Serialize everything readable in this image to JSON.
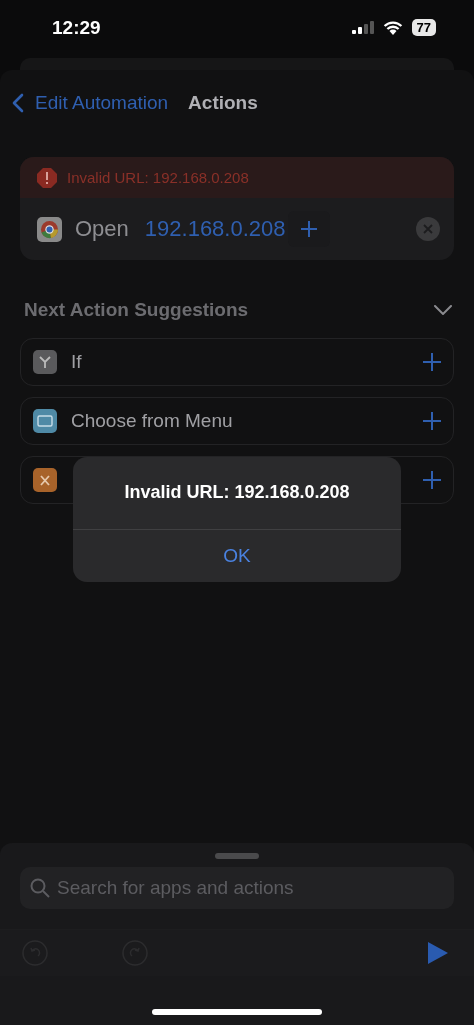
{
  "status_bar": {
    "time": "12:29",
    "battery": "77"
  },
  "nav": {
    "back": "Edit Automation",
    "title": "Actions"
  },
  "action": {
    "error": "Invalid URL: 192.168.0.208",
    "verb": "Open",
    "url": "192.168.0.208"
  },
  "suggestions": {
    "title": "Next Action Suggestions",
    "expanded": true,
    "items": [
      {
        "kind": "if",
        "label": "If"
      },
      {
        "kind": "menu",
        "label": "Choose from Menu"
      },
      {
        "kind": "variable"
      }
    ]
  },
  "alert": {
    "message": "Invalid URL: 192.168.0.208",
    "button": "OK"
  },
  "search": {
    "placeholder": "Search for apps and actions"
  }
}
